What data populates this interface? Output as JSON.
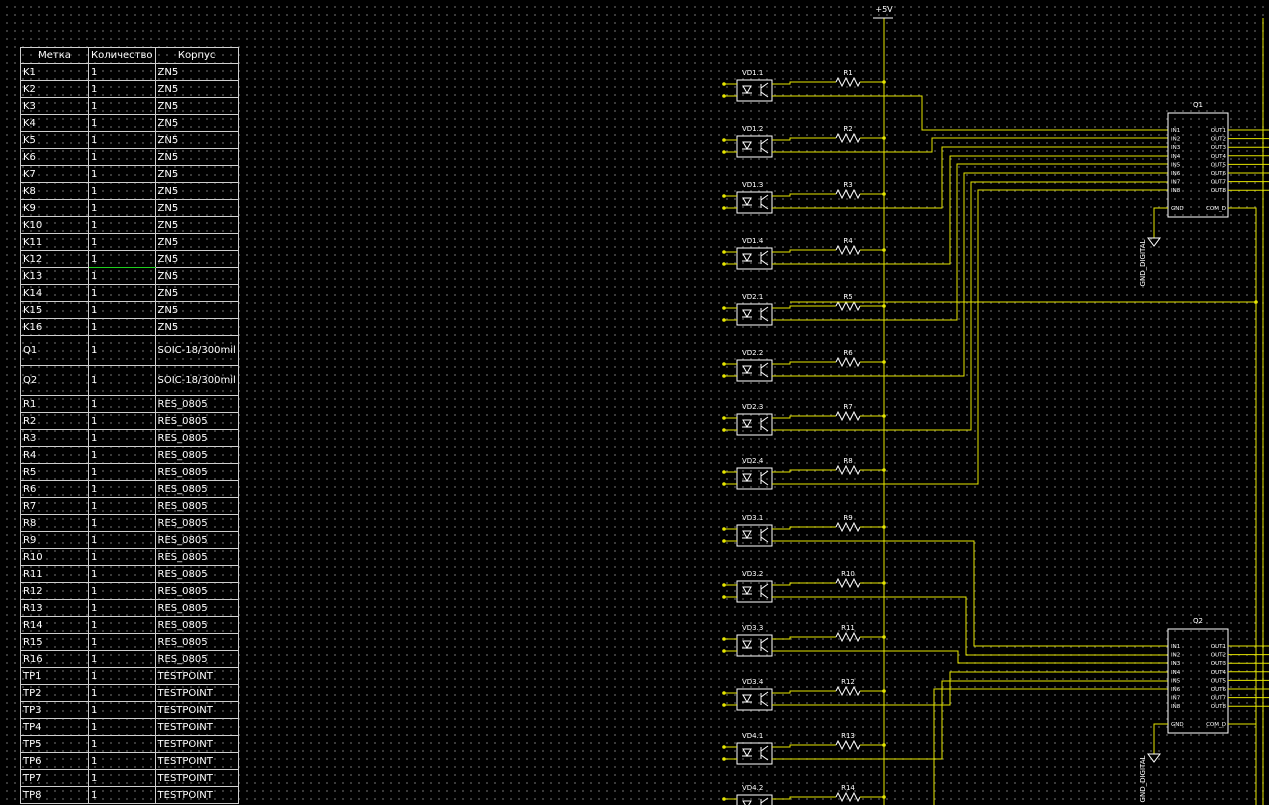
{
  "bom": {
    "columns": [
      "Метка",
      "Количество",
      "Корпус"
    ],
    "rows": [
      [
        "K1",
        "1",
        "ZN5"
      ],
      [
        "K2",
        "1",
        "ZN5"
      ],
      [
        "K3",
        "1",
        "ZN5"
      ],
      [
        "K4",
        "1",
        "ZN5"
      ],
      [
        "K5",
        "1",
        "ZN5"
      ],
      [
        "K6",
        "1",
        "ZN5"
      ],
      [
        "K7",
        "1",
        "ZN5"
      ],
      [
        "K8",
        "1",
        "ZN5"
      ],
      [
        "K9",
        "1",
        "ZN5"
      ],
      [
        "K10",
        "1",
        "ZN5"
      ],
      [
        "K11",
        "1",
        "ZN5"
      ],
      [
        "K12",
        "1",
        "ZN5"
      ],
      [
        "K13",
        "1",
        "ZN5"
      ],
      [
        "K14",
        "1",
        "ZN5"
      ],
      [
        "K15",
        "1",
        "ZN5"
      ],
      [
        "K16",
        "1",
        "ZN5"
      ],
      [
        "Q1",
        "1",
        "SOIC-18/300mil"
      ],
      [
        "Q2",
        "1",
        "SOIC-18/300mil"
      ],
      [
        "R1",
        "1",
        "RES_0805"
      ],
      [
        "R2",
        "1",
        "RES_0805"
      ],
      [
        "R3",
        "1",
        "RES_0805"
      ],
      [
        "R4",
        "1",
        "RES_0805"
      ],
      [
        "R5",
        "1",
        "RES_0805"
      ],
      [
        "R6",
        "1",
        "RES_0805"
      ],
      [
        "R7",
        "1",
        "RES_0805"
      ],
      [
        "R8",
        "1",
        "RES_0805"
      ],
      [
        "R9",
        "1",
        "RES_0805"
      ],
      [
        "R10",
        "1",
        "RES_0805"
      ],
      [
        "R11",
        "1",
        "RES_0805"
      ],
      [
        "R12",
        "1",
        "RES_0805"
      ],
      [
        "R13",
        "1",
        "RES_0805"
      ],
      [
        "R14",
        "1",
        "RES_0805"
      ],
      [
        "R15",
        "1",
        "RES_0805"
      ],
      [
        "R16",
        "1",
        "RES_0805"
      ],
      [
        "TP1",
        "1",
        "TESTPOINT"
      ],
      [
        "TP2",
        "1",
        "TESTPOINT"
      ],
      [
        "TP3",
        "1",
        "TESTPOINT"
      ],
      [
        "TP4",
        "1",
        "TESTPOINT"
      ],
      [
        "TP5",
        "1",
        "TESTPOINT"
      ],
      [
        "TP6",
        "1",
        "TESTPOINT"
      ],
      [
        "TP7",
        "1",
        "TESTPOINT"
      ],
      [
        "TP8",
        "1",
        "TESTPOINT"
      ]
    ]
  },
  "schematic": {
    "power_label": "+5V",
    "channels": [
      {
        "opto": "VD1.1",
        "res": "R1"
      },
      {
        "opto": "VD1.2",
        "res": "R2"
      },
      {
        "opto": "VD1.3",
        "res": "R3"
      },
      {
        "opto": "VD1.4",
        "res": "R4"
      },
      {
        "opto": "VD2.1",
        "res": "R5"
      },
      {
        "opto": "VD2.2",
        "res": "R6"
      },
      {
        "opto": "VD2.3",
        "res": "R7"
      },
      {
        "opto": "VD2.4",
        "res": "R8"
      },
      {
        "opto": "VD3.1",
        "res": "R9"
      },
      {
        "opto": "VD3.2",
        "res": "R10"
      },
      {
        "opto": "VD3.3",
        "res": "R11"
      },
      {
        "opto": "VD3.4",
        "res": "R12"
      },
      {
        "opto": "VD4.1",
        "res": "R13"
      },
      {
        "opto": "VD4.2",
        "res": "R14"
      }
    ],
    "ics": [
      {
        "name": "Q1",
        "gnd_label": "GND_DIGITAL"
      },
      {
        "name": "Q2",
        "gnd_label": "GND_DIGITAL"
      }
    ],
    "in_pins": [
      "IN1",
      "IN2",
      "IN3",
      "IN4",
      "IN5",
      "IN6",
      "IN7",
      "IN8"
    ],
    "out_pins": [
      "OUT1",
      "OUT2",
      "OUT3",
      "OUT4",
      "OUT5",
      "OUT6",
      "OUT7",
      "OUT8"
    ],
    "gnd_pin": "GND",
    "com_pin": "COM_D"
  },
  "colors": {
    "background": "#000000",
    "wire": "#e6e600",
    "component": "#ffffff",
    "selection": "#1fd01f"
  }
}
